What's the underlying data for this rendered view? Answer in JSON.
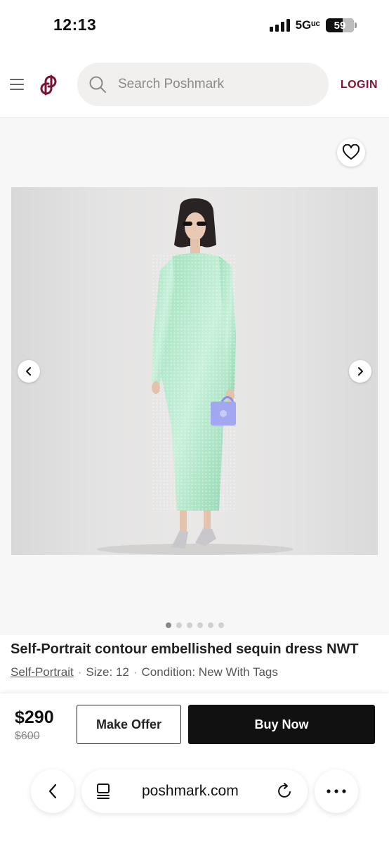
{
  "status_bar": {
    "time": "12:13",
    "network": "5Gᵘᶜ",
    "battery": "59"
  },
  "header": {
    "search_placeholder": "Search Poshmark",
    "login_label": "LOGIN",
    "brand_color": "#7a1232"
  },
  "gallery": {
    "image_count": 6,
    "active_index": 0
  },
  "product": {
    "title": "Self-Portrait contour embellished sequin dress NWT",
    "brand": "Self-Portrait",
    "size": "Size: 12",
    "condition": "Condition: New With Tags",
    "price": "$290",
    "original_price": "$600"
  },
  "actions": {
    "offer_label": "Make Offer",
    "buy_label": "Buy Now"
  },
  "browser": {
    "url": "poshmark.com"
  },
  "icons": [
    "menu-icon",
    "poshmark-logo",
    "search-icon",
    "heart-icon",
    "chevron-left-icon",
    "chevron-right-icon",
    "tabs-icon",
    "reload-icon",
    "more-icon",
    "back-icon"
  ]
}
